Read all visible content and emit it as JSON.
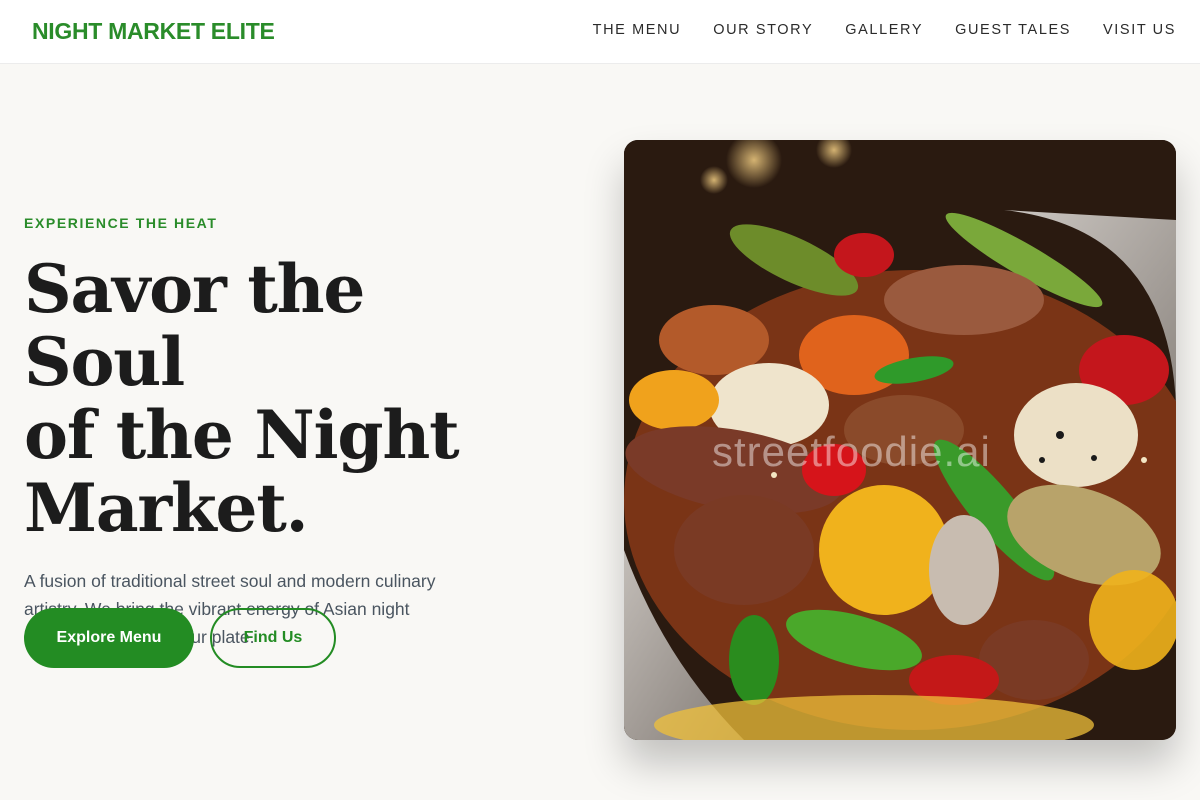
{
  "header": {
    "logo": "NIGHT MARKET ELITE",
    "nav": [
      "THE MENU",
      "OUR STORY",
      "GALLERY",
      "GUEST TALES",
      "VISIT US"
    ]
  },
  "hero": {
    "eyebrow": "EXPERIENCE THE HEAT",
    "headline_lines": [
      "Savor the Soul",
      "of the Night",
      "Market."
    ],
    "subtext": "A fusion of traditional street soul and modern culinary artistry. We bring the vibrant energy of Asian night markets straight to your plate.",
    "primary_button": "Explore Menu",
    "secondary_button": "Find Us",
    "image_watermark": "streetfoodie.ai"
  },
  "colors": {
    "brand_green": "#238c23",
    "background": "#f9f8f5",
    "header_bg": "#ffffff"
  }
}
